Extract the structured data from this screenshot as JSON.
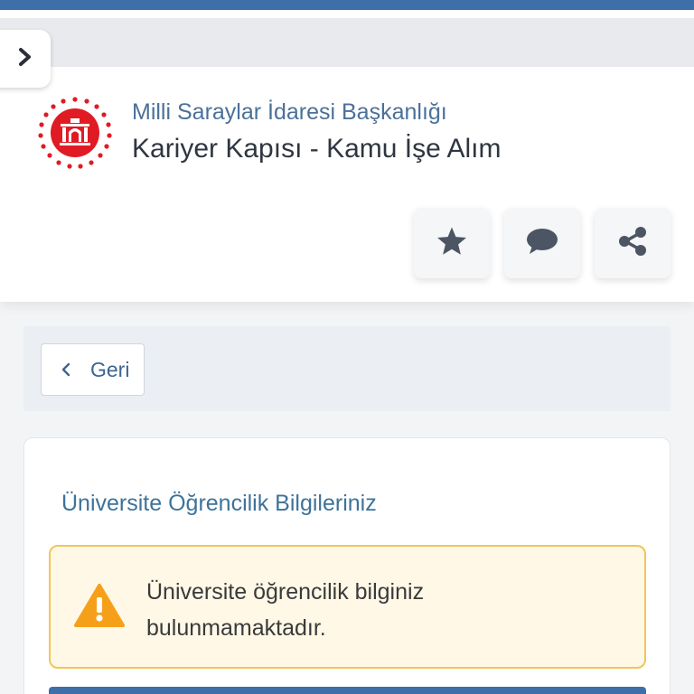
{
  "header": {
    "org_name": "Milli Saraylar İdaresi Başkanlığı",
    "portal_name": "Kariyer Kapısı - Kamu İşe Alım",
    "logo_icon": "palace-emblem-icon"
  },
  "actions": [
    {
      "icon": "star-icon"
    },
    {
      "icon": "comment-icon"
    },
    {
      "icon": "share-icon"
    }
  ],
  "nav": {
    "back_label": "Geri"
  },
  "section": {
    "title": "Üniversite Öğrencilik Bilgileriniz",
    "alert_line1": "Üniversite öğrencilik bilginiz",
    "alert_line2": "bulunmamaktadır."
  },
  "colors": {
    "brand_blue": "#3f6fa8",
    "logo_red": "#e01b24",
    "warning_orange": "#f6a01a",
    "alert_bg": "#fff8e7",
    "alert_border": "#f0c65a"
  }
}
